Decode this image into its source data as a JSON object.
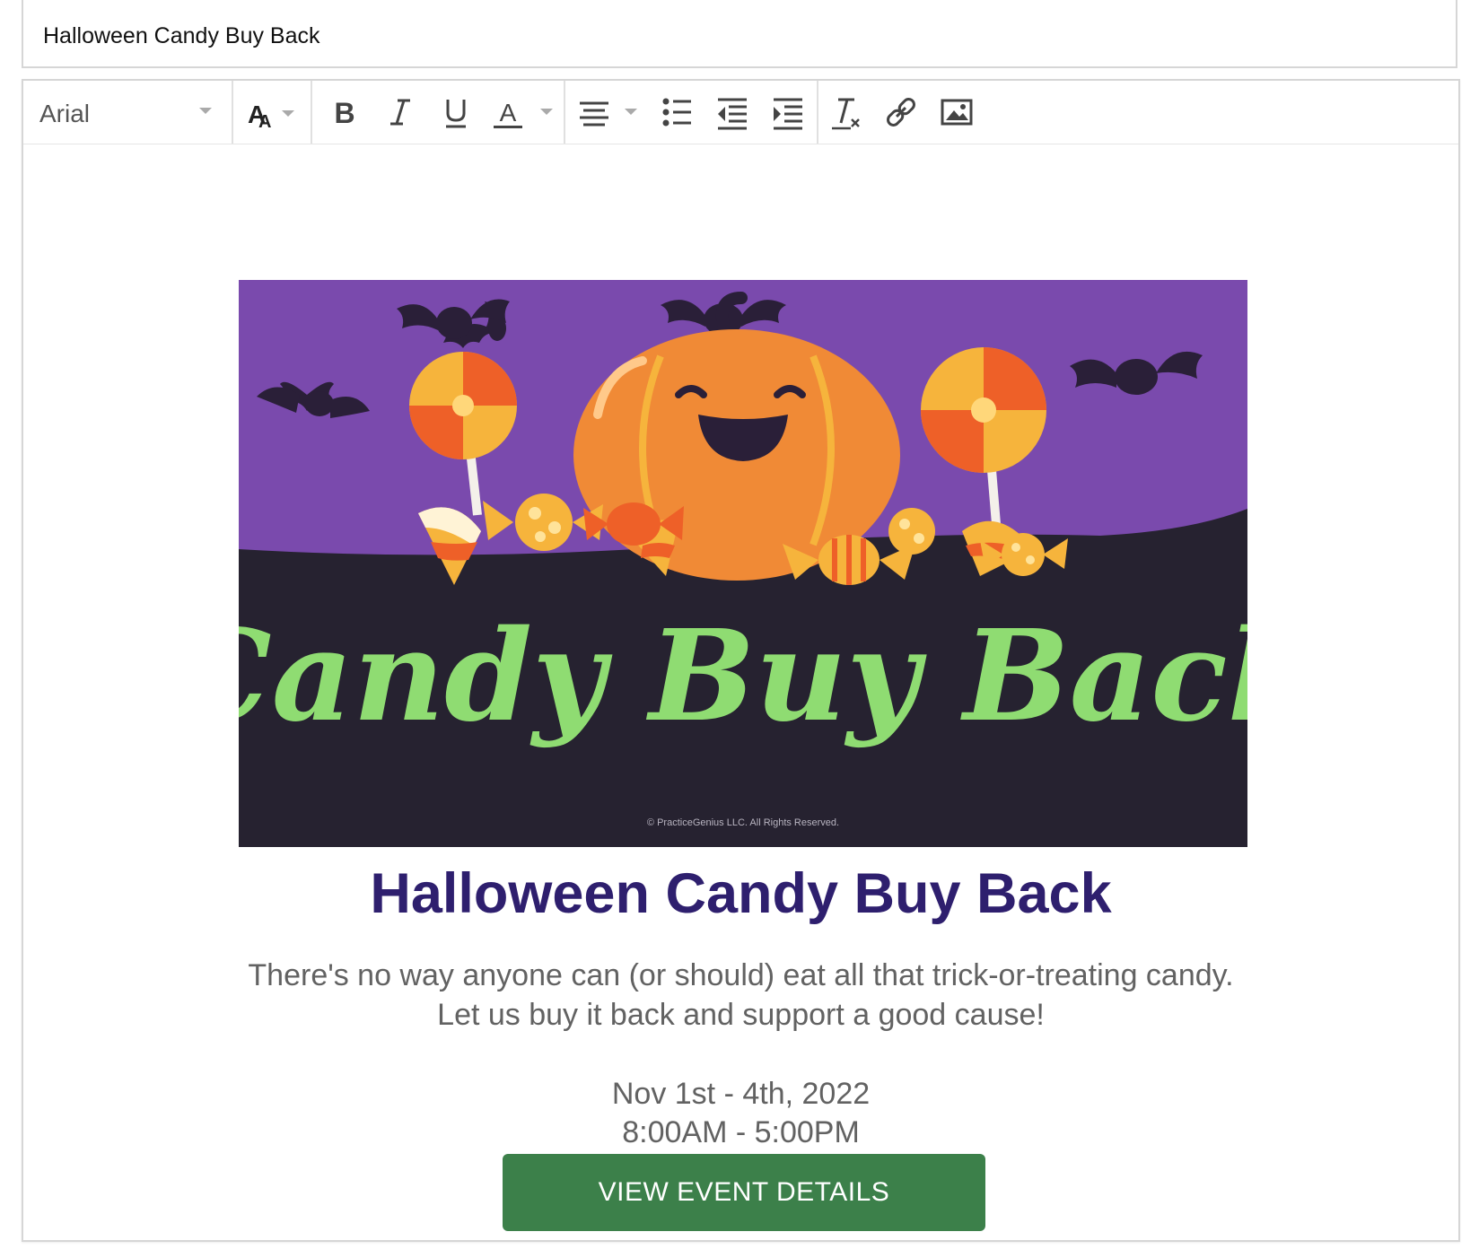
{
  "subject": {
    "value": "Halloween Candy Buy Back"
  },
  "toolbar": {
    "font_family": "Arial",
    "buttons": [
      {
        "name": "font-size",
        "icon": "font-size-icon"
      },
      {
        "name": "bold",
        "icon": "bold-icon"
      },
      {
        "name": "italic",
        "icon": "italic-icon"
      },
      {
        "name": "underline",
        "icon": "underline-icon"
      },
      {
        "name": "text-color",
        "icon": "text-color-icon"
      },
      {
        "name": "align",
        "icon": "align-center-icon"
      },
      {
        "name": "bulleted-list",
        "icon": "bullet-list-icon"
      },
      {
        "name": "outdent",
        "icon": "outdent-icon"
      },
      {
        "name": "indent",
        "icon": "indent-icon"
      },
      {
        "name": "clear-formatting",
        "icon": "clear-format-icon"
      },
      {
        "name": "insert-link",
        "icon": "link-icon"
      },
      {
        "name": "insert-image",
        "icon": "image-icon"
      }
    ]
  },
  "banner": {
    "title": "Candy Buy Back",
    "copyright": "© PracticeGenius LLC. All Rights Reserved.",
    "colors": {
      "sky": "#7a4aad",
      "ground": "#262230",
      "letters": "#8fdc72",
      "pumpkin": "#f08a36"
    }
  },
  "email": {
    "heading": "Halloween Candy Buy Back",
    "line1": "There's no way anyone can (or should) eat all that trick-or-treating candy.",
    "line2": "Let us buy it back and support a good cause!",
    "date": "Nov 1st - 4th, 2022",
    "time": "8:00AM - 5:00PM",
    "cta_label": "VIEW EVENT DETAILS"
  },
  "colors": {
    "heading": "#2e1f6e",
    "body": "#626262",
    "cta": "#3c804a"
  }
}
